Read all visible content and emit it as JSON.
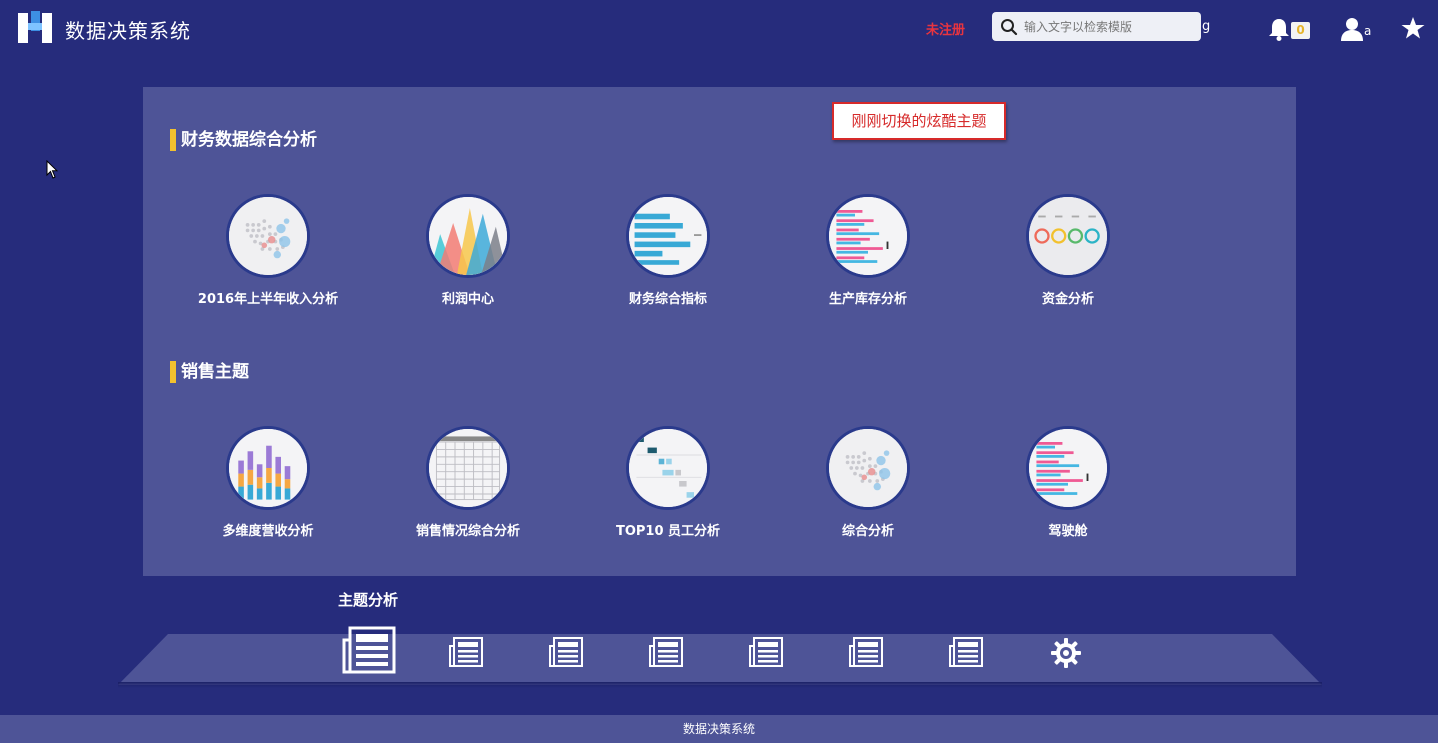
{
  "header": {
    "app_title": "数据决策系统",
    "unregistered_label": "未注册",
    "search_placeholder": "输入文字以检索模版",
    "search_suffix": "g",
    "notification_count": "0",
    "user_name": "a"
  },
  "tooltip": "刚刚切换的炫酷主题",
  "sections": [
    {
      "title": "财务数据综合分析",
      "items": [
        {
          "label": "2016年上半年收入分析",
          "thumb": "map-icon"
        },
        {
          "label": "利润中心",
          "thumb": "mountain-chart-icon"
        },
        {
          "label": "财务综合指标",
          "thumb": "bar-chart-icon"
        },
        {
          "label": "生产库存分析",
          "thumb": "multi-bar-chart-icon"
        },
        {
          "label": "资金分析",
          "thumb": "ring-gauge-icon"
        }
      ]
    },
    {
      "title": "销售主题",
      "items": [
        {
          "label": "多维度营收分析",
          "thumb": "stacked-column-icon"
        },
        {
          "label": "销售情况综合分析",
          "thumb": "table-grid-icon"
        },
        {
          "label": "TOP10 员工分析",
          "thumb": "gantt-chart-icon"
        },
        {
          "label": "综合分析",
          "thumb": "map-icon"
        },
        {
          "label": "驾驶舱",
          "thumb": "multi-bar-chart-icon"
        }
      ]
    }
  ],
  "dock": {
    "title": "主题分析",
    "items": [
      "newspaper-icon",
      "newspaper-icon",
      "newspaper-icon",
      "newspaper-icon",
      "newspaper-icon",
      "newspaper-icon",
      "newspaper-icon",
      "gear-icon"
    ]
  },
  "footer": "数据决策系统",
  "colors": {
    "background": "#262c7c",
    "panel": "#4e5497",
    "accent_bar": "#f2c12e",
    "unregistered": "#e8343f",
    "tooltip_border": "#d62a2a"
  }
}
